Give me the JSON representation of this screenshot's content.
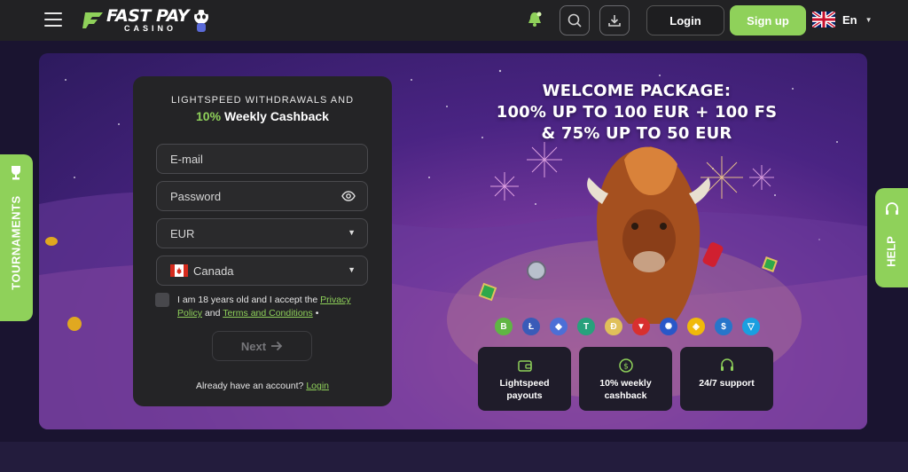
{
  "header": {
    "brand_main": "FAST PAY",
    "brand_sub": "CASINO",
    "login_label": "Login",
    "signup_label": "Sign up",
    "language": "En"
  },
  "form": {
    "headline_line1": "LIGHTSPEED WITHDRAWALS AND",
    "headline_accent": "10%",
    "headline_rest": "Weekly Cashback",
    "email_placeholder": "E-mail",
    "password_placeholder": "Password",
    "currency_value": "EUR",
    "country_value": "Canada",
    "consent_prefix": "I am 18 years old and I accept the",
    "consent_link1": "Privacy Policy",
    "consent_and": "and",
    "consent_link2": "Terms and Conditions",
    "consent_required": "•",
    "next_label": "Next",
    "already_text": "Already have an account?",
    "already_link": "Login"
  },
  "promo": {
    "line1": "WELCOME PACKAGE:",
    "line2": "100% UP TO 100 EUR + 100 FS",
    "line3": "& 75% UP TO 50 EUR"
  },
  "cryptos": [
    {
      "name": "bitcoin",
      "glyph": "B",
      "color": "#5fb544"
    },
    {
      "name": "litecoin",
      "glyph": "Ł",
      "color": "#3a5bb8"
    },
    {
      "name": "ethereum",
      "glyph": "◆",
      "color": "#4d6fd6"
    },
    {
      "name": "tether",
      "glyph": "T",
      "color": "#27a17c"
    },
    {
      "name": "dogecoin",
      "glyph": "Ð",
      "color": "#e0c05a"
    },
    {
      "name": "tron",
      "glyph": "▼",
      "color": "#d8302f"
    },
    {
      "name": "cardano",
      "glyph": "✺",
      "color": "#2a57c8"
    },
    {
      "name": "binance",
      "glyph": "◈",
      "color": "#f0b90b"
    },
    {
      "name": "usd-coin",
      "glyph": "$",
      "color": "#2775ca"
    },
    {
      "name": "toncoin",
      "glyph": "▽",
      "color": "#1a9fe0"
    }
  ],
  "features": [
    {
      "line1": "Lightspeed",
      "line2": "payouts"
    },
    {
      "line1": "10% weekly",
      "line2": "cashback"
    },
    {
      "line1": "24/7 support",
      "line2": ""
    }
  ],
  "side_tabs": {
    "tournaments": "TOURNAMENTS",
    "help": "HELP"
  },
  "colors": {
    "accent": "#8fd15a",
    "header_bg": "#222224",
    "card_bg": "#242426"
  }
}
